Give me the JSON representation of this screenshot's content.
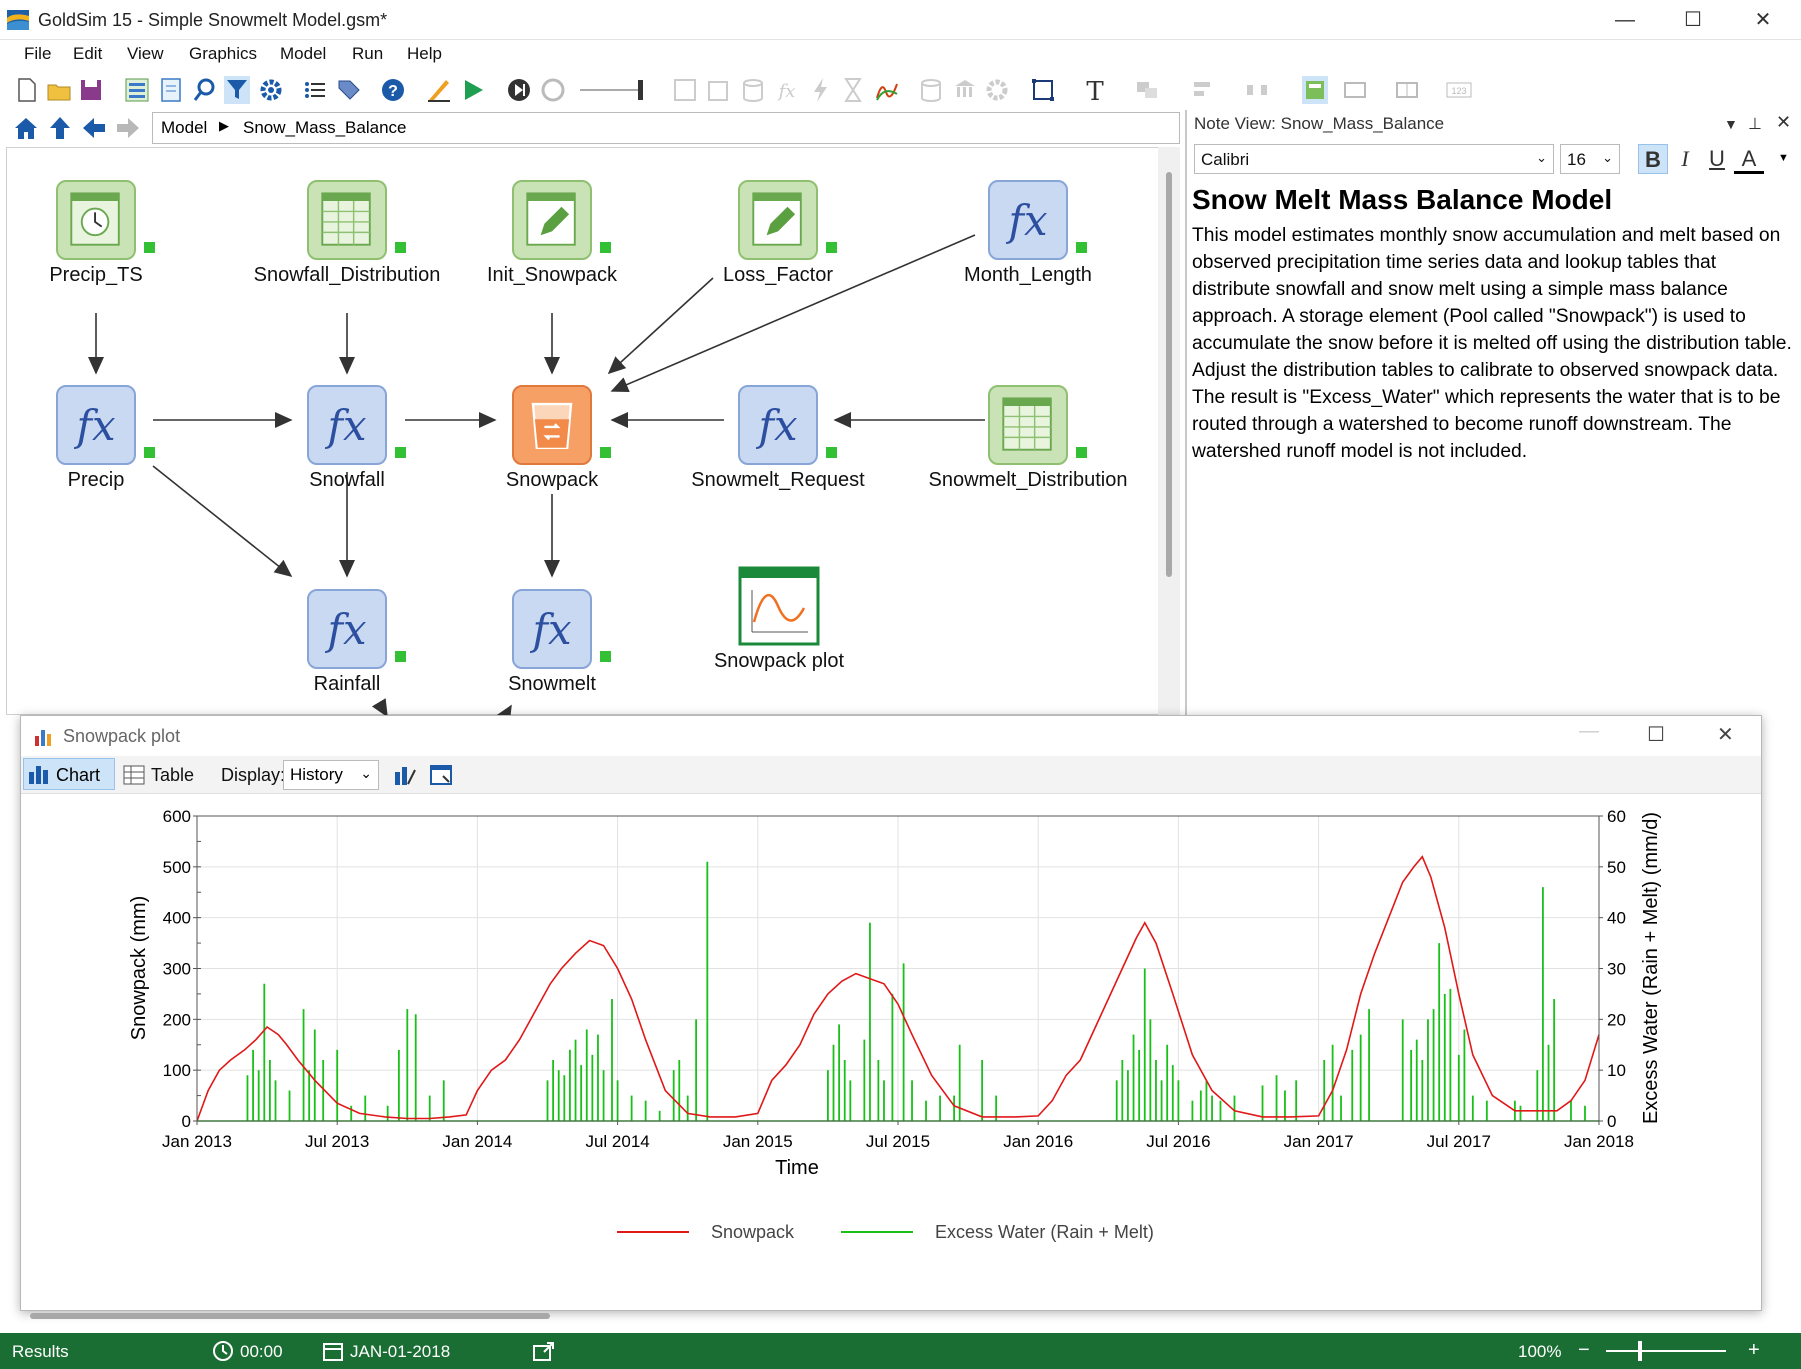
{
  "window": {
    "app": "GoldSim 15",
    "title": "GoldSim 15  - Simple Snowmelt Model.gsm*"
  },
  "menu": [
    "File",
    "Edit",
    "View",
    "Graphics",
    "Model",
    "Run",
    "Help"
  ],
  "breadcrumb": {
    "root": "Model",
    "current": "Snow_Mass_Balance"
  },
  "nodes": {
    "precip_ts": "Precip_TS",
    "snowfall_distribution": "Snowfall_Distribution",
    "init_snowpack": "Init_Snowpack",
    "loss_factor": "Loss_Factor",
    "month_length": "Month_Length",
    "precip": "Precip",
    "snowfall": "Snowfall",
    "snowpack": "Snowpack",
    "snowmelt_request": "Snowmelt_Request",
    "snowmelt_distribution": "Snowmelt_Distribution",
    "rainfall": "Rainfall",
    "snowmelt": "Snowmelt",
    "snowpack_plot": "Snowpack plot"
  },
  "note": {
    "header": "Note View: Snow_Mass_Balance",
    "font": "Calibri",
    "size": "16",
    "title": "Snow Melt Mass Balance Model",
    "body": "This model estimates monthly snow accumulation and melt based on observed precipitation time series data and lookup tables that distribute snowfall and snow melt using a simple mass balance approach. A storage element (Pool called \"Snowpack\") is used to accumulate the snow before it is melted off using the distribution table. Adjust the distribution tables to calibrate to observed snowpack data. The result is \"Excess_Water\" which represents the water that is to be routed through a watershed to become runoff downstream. The watershed runoff model is not included."
  },
  "plot_window": {
    "title": "Snowpack plot",
    "tab_chart": "Chart",
    "tab_table": "Table",
    "display_label": "Display:",
    "display_value": "History"
  },
  "chart_data": {
    "type": "line",
    "xlabel": "Time",
    "ylabel": "Snowpack (mm)",
    "y2label": "Excess Water (Rain + Melt) (mm/d)",
    "ylim": [
      0,
      600
    ],
    "y2lim": [
      0,
      60
    ],
    "yticks": [
      "0",
      "100",
      "200",
      "300",
      "400",
      "500",
      "600"
    ],
    "y2ticks": [
      "0",
      "10",
      "20",
      "30",
      "40",
      "50",
      "60"
    ],
    "xticks": [
      "Jan 2013",
      "Jul 2013",
      "Jan 2014",
      "Jul 2014",
      "Jan 2015",
      "Jul 2015",
      "Jan 2016",
      "Jul 2016",
      "Jan 2017",
      "Jul 2017",
      "Jan 2018"
    ],
    "grid": true,
    "legend": "bottom",
    "series": [
      {
        "name": "Snowpack",
        "axis": "left",
        "color": "#e01818",
        "x": [
          2013.0,
          2013.04,
          2013.08,
          2013.12,
          2013.17,
          2013.21,
          2013.25,
          2013.29,
          2013.32,
          2013.36,
          2013.42,
          2013.5,
          2013.58,
          2013.67,
          2013.75,
          2013.83,
          2013.9,
          2013.96,
          2014.0,
          2014.05,
          2014.1,
          2014.15,
          2014.2,
          2014.26,
          2014.3,
          2014.35,
          2014.4,
          2014.45,
          2014.5,
          2014.55,
          2014.6,
          2014.67,
          2014.75,
          2014.83,
          2014.92,
          2015.0,
          2015.05,
          2015.1,
          2015.15,
          2015.2,
          2015.25,
          2015.3,
          2015.35,
          2015.4,
          2015.45,
          2015.5,
          2015.55,
          2015.62,
          2015.7,
          2015.8,
          2015.92,
          2016.0,
          2016.05,
          2016.1,
          2016.15,
          2016.2,
          2016.25,
          2016.3,
          2016.35,
          2016.38,
          2016.42,
          2016.48,
          2016.55,
          2016.62,
          2016.7,
          2016.8,
          2016.9,
          2017.0,
          2017.05,
          2017.1,
          2017.15,
          2017.2,
          2017.25,
          2017.3,
          2017.34,
          2017.37,
          2017.4,
          2017.45,
          2017.5,
          2017.55,
          2017.62,
          2017.7,
          2017.8,
          2017.85,
          2017.9,
          2017.95,
          2018.0
        ],
        "y": [
          0,
          60,
          100,
          120,
          140,
          160,
          185,
          170,
          150,
          120,
          80,
          35,
          15,
          8,
          5,
          5,
          8,
          12,
          60,
          100,
          120,
          160,
          210,
          270,
          300,
          330,
          355,
          345,
          300,
          240,
          160,
          60,
          15,
          8,
          8,
          15,
          80,
          110,
          150,
          210,
          250,
          275,
          290,
          280,
          270,
          230,
          170,
          90,
          30,
          8,
          8,
          10,
          40,
          90,
          120,
          180,
          240,
          300,
          360,
          390,
          350,
          250,
          130,
          60,
          20,
          8,
          8,
          10,
          60,
          140,
          250,
          330,
          400,
          470,
          500,
          520,
          480,
          380,
          250,
          130,
          50,
          20,
          20,
          20,
          40,
          80,
          170
        ]
      },
      {
        "name": "Excess Water (Rain + Melt)",
        "axis": "right",
        "color": "#18c018",
        "spikes": [
          [
            2013.18,
            9
          ],
          [
            2013.2,
            14
          ],
          [
            2013.22,
            10
          ],
          [
            2013.24,
            27
          ],
          [
            2013.26,
            12
          ],
          [
            2013.28,
            8
          ],
          [
            2013.33,
            6
          ],
          [
            2013.38,
            22
          ],
          [
            2013.4,
            10
          ],
          [
            2013.42,
            18
          ],
          [
            2013.45,
            12
          ],
          [
            2013.5,
            14
          ],
          [
            2013.55,
            3
          ],
          [
            2013.6,
            5
          ],
          [
            2013.68,
            3
          ],
          [
            2013.72,
            14
          ],
          [
            2013.75,
            22
          ],
          [
            2013.78,
            21
          ],
          [
            2013.83,
            5
          ],
          [
            2013.88,
            8
          ],
          [
            2014.25,
            8
          ],
          [
            2014.27,
            12
          ],
          [
            2014.29,
            10
          ],
          [
            2014.31,
            9
          ],
          [
            2014.33,
            14
          ],
          [
            2014.35,
            16
          ],
          [
            2014.37,
            11
          ],
          [
            2014.39,
            18
          ],
          [
            2014.41,
            13
          ],
          [
            2014.43,
            17
          ],
          [
            2014.45,
            10
          ],
          [
            2014.48,
            24
          ],
          [
            2014.5,
            8
          ],
          [
            2014.55,
            5
          ],
          [
            2014.6,
            4
          ],
          [
            2014.65,
            2
          ],
          [
            2014.7,
            10
          ],
          [
            2014.72,
            12
          ],
          [
            2014.75,
            5
          ],
          [
            2014.78,
            20
          ],
          [
            2014.82,
            51
          ],
          [
            2015.25,
            10
          ],
          [
            2015.27,
            15
          ],
          [
            2015.29,
            19
          ],
          [
            2015.31,
            12
          ],
          [
            2015.33,
            8
          ],
          [
            2015.38,
            16
          ],
          [
            2015.4,
            39
          ],
          [
            2015.43,
            12
          ],
          [
            2015.45,
            8
          ],
          [
            2015.48,
            25
          ],
          [
            2015.52,
            31
          ],
          [
            2015.55,
            8
          ],
          [
            2015.6,
            4
          ],
          [
            2015.65,
            5
          ],
          [
            2015.7,
            5
          ],
          [
            2015.72,
            15
          ],
          [
            2015.8,
            12
          ],
          [
            2015.85,
            5
          ],
          [
            2016.28,
            8
          ],
          [
            2016.3,
            12
          ],
          [
            2016.32,
            10
          ],
          [
            2016.34,
            17
          ],
          [
            2016.36,
            14
          ],
          [
            2016.38,
            30
          ],
          [
            2016.4,
            20
          ],
          [
            2016.42,
            12
          ],
          [
            2016.44,
            8
          ],
          [
            2016.46,
            15
          ],
          [
            2016.48,
            11
          ],
          [
            2016.5,
            8
          ],
          [
            2016.55,
            4
          ],
          [
            2016.58,
            6
          ],
          [
            2016.6,
            8
          ],
          [
            2016.62,
            5
          ],
          [
            2016.65,
            4
          ],
          [
            2016.7,
            5
          ],
          [
            2016.8,
            7
          ],
          [
            2016.85,
            9
          ],
          [
            2016.88,
            6
          ],
          [
            2016.92,
            8
          ],
          [
            2017.02,
            12
          ],
          [
            2017.05,
            15
          ],
          [
            2017.08,
            5
          ],
          [
            2017.12,
            14
          ],
          [
            2017.15,
            17
          ],
          [
            2017.18,
            22
          ],
          [
            2017.3,
            20
          ],
          [
            2017.33,
            14
          ],
          [
            2017.35,
            16
          ],
          [
            2017.37,
            12
          ],
          [
            2017.39,
            20
          ],
          [
            2017.41,
            22
          ],
          [
            2017.43,
            35
          ],
          [
            2017.45,
            25
          ],
          [
            2017.47,
            26
          ],
          [
            2017.5,
            13
          ],
          [
            2017.52,
            18
          ],
          [
            2017.55,
            5
          ],
          [
            2017.6,
            4
          ],
          [
            2017.7,
            4
          ],
          [
            2017.72,
            3
          ],
          [
            2017.78,
            10
          ],
          [
            2017.8,
            46
          ],
          [
            2017.82,
            15
          ],
          [
            2017.84,
            24
          ],
          [
            2017.9,
            4
          ],
          [
            2017.95,
            3
          ]
        ]
      }
    ]
  },
  "status": {
    "mode": "Results",
    "clock": "00:00",
    "date": "JAN-01-2018",
    "zoom": "100%"
  }
}
